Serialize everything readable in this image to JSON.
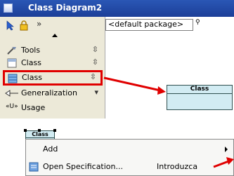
{
  "window": {
    "title": "Class Diagram2"
  },
  "palette": {
    "items": [
      {
        "label": "Tools",
        "expander": "⇳"
      },
      {
        "label": "Class",
        "expander": "⇳"
      },
      {
        "label": "Class",
        "expander": "⇳"
      },
      {
        "label": "Generalization",
        "expander": "▾"
      },
      {
        "label": "Usage",
        "icon_text": "«U»"
      }
    ]
  },
  "canvas": {
    "package_selector": "<default package>",
    "class_box_title": "Class"
  },
  "diagram": {
    "mini_class_title": "Class"
  },
  "context_menu": {
    "items": [
      {
        "label": "Add",
        "has_submenu": true
      },
      {
        "label": "Open Specification...",
        "shortcut": "Introduzca"
      }
    ]
  },
  "colors": {
    "title_bar": "#2a57b5",
    "highlight": "#e00000",
    "class_fill": "#d2ecf3"
  }
}
